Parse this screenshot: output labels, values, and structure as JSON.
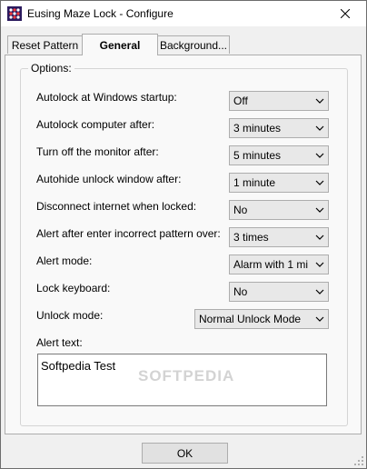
{
  "window": {
    "title": "Eusing Maze Lock - Configure",
    "close_icon": "close-icon",
    "app_icon": "maze-lock-icon"
  },
  "tabs": [
    {
      "label": "Reset Pattern",
      "active": false
    },
    {
      "label": "General",
      "active": true
    },
    {
      "label": "Background...",
      "active": false
    }
  ],
  "options": {
    "group_label": "Options:",
    "rows": [
      {
        "label": "Autolock at Windows startup:",
        "value": "Off"
      },
      {
        "label": "Autolock computer after:",
        "value": "3 minutes"
      },
      {
        "label": "Turn off the monitor after:",
        "value": "5 minutes"
      },
      {
        "label": "Autohide unlock window after:",
        "value": "1 minute"
      },
      {
        "label": "Disconnect internet when locked:",
        "value": "No"
      },
      {
        "label": "Alert after enter incorrect pattern over:",
        "value": "3 times"
      },
      {
        "label": "Alert mode:",
        "value": "Alarm with 1 mi"
      },
      {
        "label": "Lock keyboard:",
        "value": "No"
      },
      {
        "label": "Unlock mode:",
        "value": "Normal Unlock Mode"
      }
    ],
    "alert_text_label": "Alert text:",
    "alert_text_value": "Softpedia Test"
  },
  "footer": {
    "ok_label": "OK"
  },
  "watermark": "SOFTPEDIA"
}
